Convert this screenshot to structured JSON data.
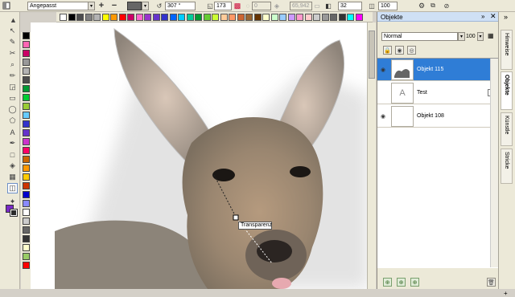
{
  "propbar": {
    "preset": "Angepasst",
    "angle": "307 °",
    "edge": "173",
    "disabled_value": "0",
    "midpoint": "65,942",
    "steps": "32",
    "opacity": "100"
  },
  "palette_colors": [
    "#ffffff",
    "#000000",
    "#4d4d4d",
    "#808080",
    "#b3b3b3",
    "#ffff00",
    "#ff9900",
    "#ff0000",
    "#cc0066",
    "#ff66cc",
    "#9933cc",
    "#6633cc",
    "#3333cc",
    "#0066ff",
    "#00ccff",
    "#00cc99",
    "#009933",
    "#66cc33",
    "#ccff33",
    "#ffcc99",
    "#ff9966",
    "#cc6633",
    "#996633",
    "#663300",
    "#ffffcc",
    "#ccffcc",
    "#99ccff",
    "#cc99ff",
    "#ff99cc",
    "#ffcccc",
    "#cccccc",
    "#999999",
    "#666666",
    "#333333",
    "#00ffff",
    "#ff00ff"
  ],
  "vpalette_colors": [
    "#000000",
    "#ff66b3",
    "#cc0066",
    "#999999",
    "#b3b3b3",
    "#4d4d4d",
    "#009933",
    "#00cc33",
    "#99cc33",
    "#66ccff",
    "#3333cc",
    "#6633cc",
    "#cc33cc",
    "#ff0066",
    "#cc6600",
    "#ff9900",
    "#ffcc00",
    "#cc3300",
    "#0000cc",
    "#8a8aff",
    "#ffffff",
    "#cccccc",
    "#666666",
    "#333333",
    "#ffffcc",
    "#99cc66",
    "#ff0000"
  ],
  "tooltip": "Transparenz",
  "objects_panel": {
    "title": "Objekte",
    "blend_mode": "Normal",
    "opacity": "100",
    "layers": [
      {
        "name": "Objekt 115",
        "selected": true
      },
      {
        "name": "Test",
        "selected": false
      },
      {
        "name": "Objekt 108",
        "selected": false
      }
    ]
  },
  "right_tabs": [
    "Hinweise",
    "Objekte",
    "Künstle",
    "Stricke"
  ]
}
